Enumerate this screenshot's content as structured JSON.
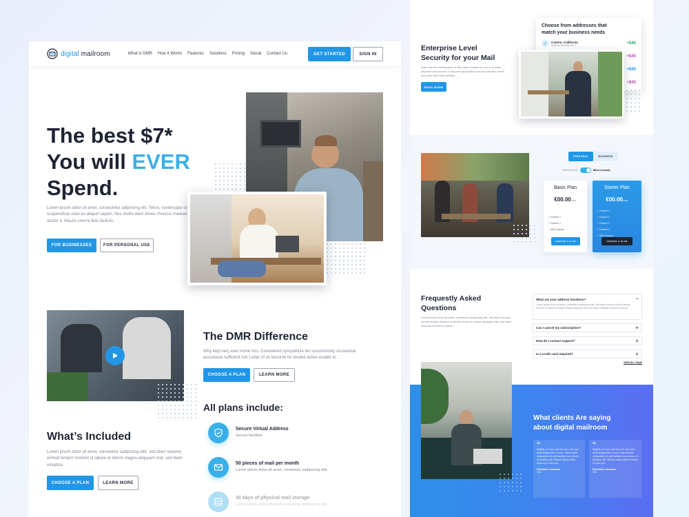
{
  "nav": {
    "logo": {
      "part1": "digital",
      "part2": "mailroom"
    },
    "links": [
      "What is DMR",
      "How it Works",
      "Features",
      "Solutions",
      "Pricing",
      "Social",
      "Contact Us"
    ],
    "get_started": "GET STARTED",
    "sign_in": "SIGN IN"
  },
  "hero": {
    "line1": "The best $7*",
    "line2a": "You will ",
    "line2b": "EVER",
    "line3": "Spend.",
    "body": "Lorem ipsum dolor sit amet, consectetur adipiscing elit. Tellus, scelerisque orci suspendisse vitae eu aliquet sapien. Nec mollis diam donec rhoncus maecenas auctor a. Mauris viverra felis facilisis.",
    "btn_business": "FOR BUSINESSES",
    "btn_personal": "FOR PERSONAL USE"
  },
  "dmr": {
    "title": "The DMR Difference",
    "body": "Why kept very ever home mrs. Considered sympathize ten uncommonly occasional assistance sufficient not. Letter of on become he tended active enable to.",
    "btn_plan": "CHOOSE A PLAN",
    "btn_learn": "LEARN MORE"
  },
  "included": {
    "title": "What’s Included",
    "body": "Lorem ipsum dolor sit amet, consetetur sadipscing elitr, sed diam nonumy eirmod tempor invidunt ut labore et dolore magna aliquyam erat, sed diam voluptua.",
    "btn_plan": "CHOOSE A PLAN",
    "btn_learn": "LEARN MORE"
  },
  "plans": {
    "title": "All plans include:",
    "features": [
      {
        "title": "Secure Virtual Address",
        "sub": "Secure facilities",
        "icon": "shield-icon"
      },
      {
        "title": "50 pieces of mail per month",
        "sub": "Lorem ipsum dolor sit amet, consetetur sadipscing elitr.",
        "icon": "envelope-icon"
      },
      {
        "title": "30 days of physical mail storage",
        "sub": "Lorem ipsum dolor sit amet, consetetur sadipscing elitr.",
        "icon": "storage-icon"
      }
    ]
  },
  "enterprise": {
    "title1": "Enterprise Level",
    "title2": "Security for your Mail",
    "body": "With real time transactions, it will make it easier for you to monitor payment and income. It only one application and you can also check accounts with other families.",
    "btn": "READ MORE",
    "address_card": {
      "title1": "Choose from addresses that",
      "title2": "match your business needs",
      "location": "Canton, California",
      "sub": "Address Security Tier 1",
      "prices": [
        "+$45",
        "+$45",
        "+$45",
        "+$45"
      ]
    }
  },
  "pricing": {
    "tab_personal": "PERSONAL",
    "tab_business": "BUSINESS",
    "toggle_left": "Billed Monthly",
    "toggle_right": "Billed Annually",
    "basic": {
      "name": "Basic Plan",
      "price": "€00.00",
      "per": "/year",
      "features": [
        "Feature 1",
        "Feature 2",
        "50$ of space"
      ],
      "btn": "CHOOSE A PLAN"
    },
    "starter": {
      "name": "Starter Plan",
      "price": "€00.00",
      "per": "/year",
      "features": [
        "Feature 1",
        "Feature 2",
        "Feature 3",
        "Feature 4",
        "50$ of space"
      ],
      "btn": "CHOOSE A PLAN"
    }
  },
  "faq": {
    "title1": "Frequestly Asked",
    "title2": "Questions",
    "body": "Lorem ipsum dolor sit amet, consetetur sadipscing elitr, sed diam nonumy eirmod tempor invidunt ut labore et dolore magna aliquyam erat, sed diam voluptua invidunt ut labore.",
    "items": [
      {
        "q": "What are your address locations?",
        "a": "Lorem ipsum dolor sit amet, consetetur sadipscing elitr, sed diam nonumy eirmod tempor invidunt ut labore et dolore magna aliquyam erat, sed diam voluptua invidunt ut labore."
      },
      {
        "q": "Can I cancel my subscription?"
      },
      {
        "q": "How do I contact support?"
      },
      {
        "q": "Is a credit card required?"
      }
    ],
    "view_all": "VIEW ALL FAQS"
  },
  "testimonials": {
    "title1": "What clients Are saying",
    "title2": "about digital mailroom",
    "quotes": [
      {
        "text": "Sagittis, eu nunc sed dui ut id, sem sed amet tempus est ut nunc. Sed et amet consectetur ut odio facilisis nunc donec, ut faucibus nisl. Mauris massa etiam rhoncus in nunc sed.",
        "name": "Firstname Lastname",
        "role": "Title"
      },
      {
        "text": "Sagittis, eu nunc sed dui ut id, sem sed amet tempus est ut nunc. Sed et amet consectetur ut odio facilisis nunc donec, ut faucibus nisl. Mauris massa etiam rhoncus in nunc sed.",
        "name": "Firstname Lastname",
        "role": "Title"
      }
    ]
  },
  "colors": {
    "accent": "#2196e6",
    "highlight": "#3ab0e8",
    "dark": "#1d2433",
    "grad_start": "#2d8fe8",
    "grad_end": "#5b6ef0",
    "price_purple": "#c04ab8",
    "price_teal": "#29a86a"
  }
}
